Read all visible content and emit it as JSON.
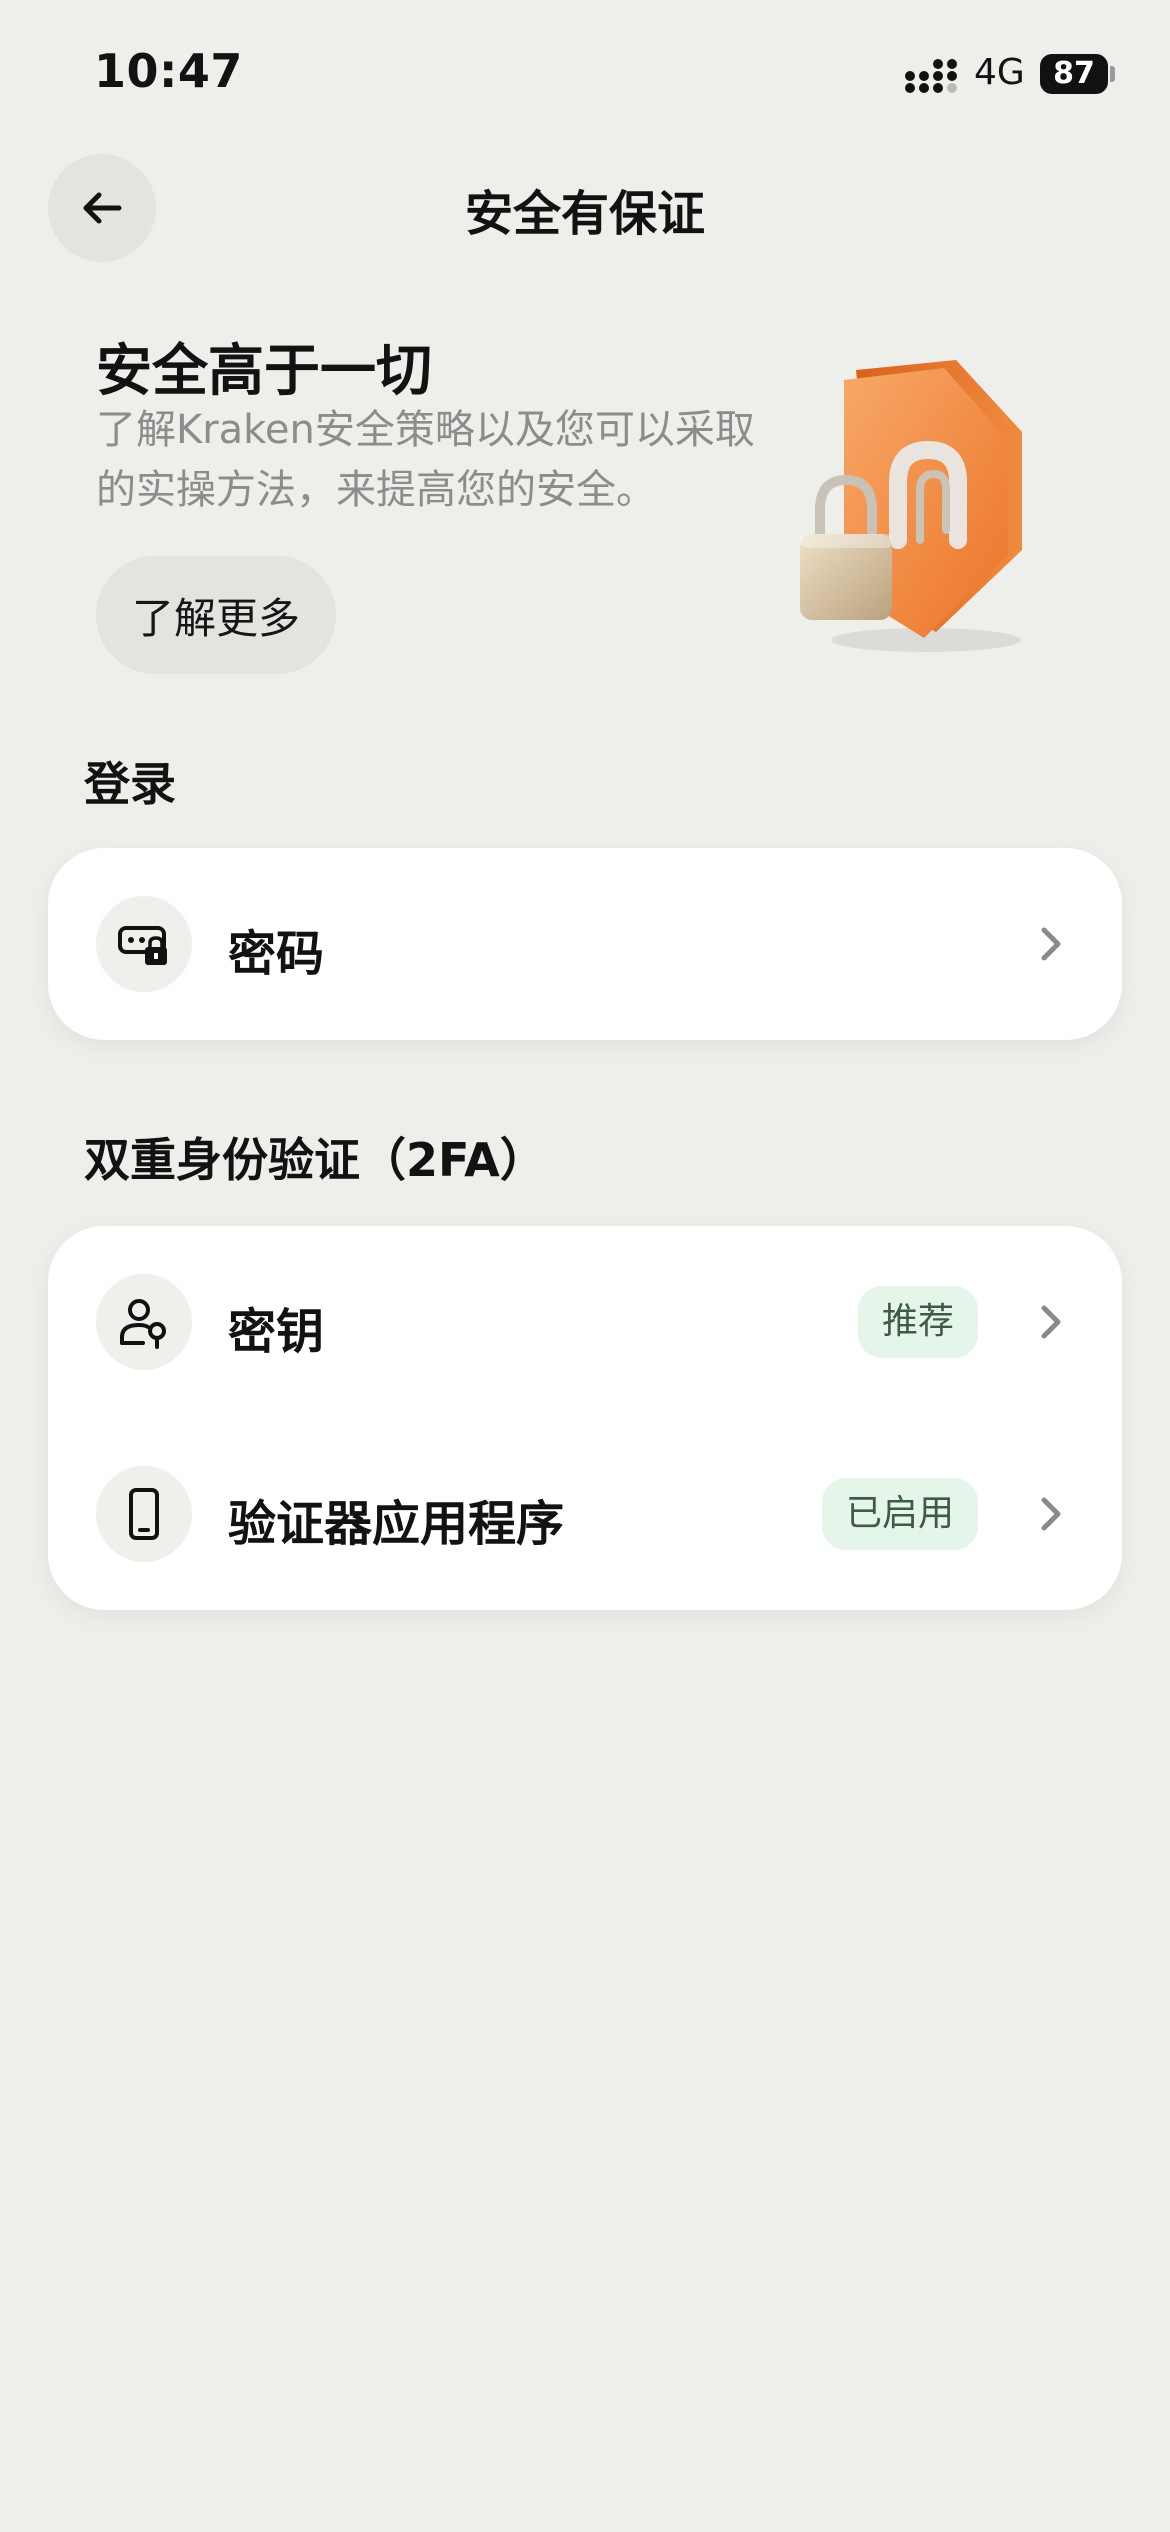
{
  "status_bar": {
    "time": "10:47",
    "network": "4G",
    "battery": "87"
  },
  "header": {
    "title": "安全有保证",
    "back_icon": "arrow-left-icon"
  },
  "hero": {
    "title": "安全高于一切",
    "description": "了解Kraken安全策略以及您可以采取的实操方法，来提高您的安全。",
    "learn_more_label": "了解更多",
    "illustration": "shield-padlock-illustration"
  },
  "login_section": {
    "label": "登录",
    "items": [
      {
        "label": "密码",
        "icon": "password-lock-icon"
      }
    ]
  },
  "twofa_section": {
    "label": "双重身份验证（2FA）",
    "items": [
      {
        "label": "密钥",
        "icon": "passkey-user-icon",
        "badge": "推荐"
      },
      {
        "label": "验证器应用程序",
        "icon": "phone-icon",
        "badge": "已启用"
      }
    ]
  },
  "colors": {
    "background": "#eeeeea",
    "card": "#ffffff",
    "badge_bg": "#e6f5ea",
    "badge_text": "#3f5a46",
    "accent_orange": "#f07a2e"
  }
}
